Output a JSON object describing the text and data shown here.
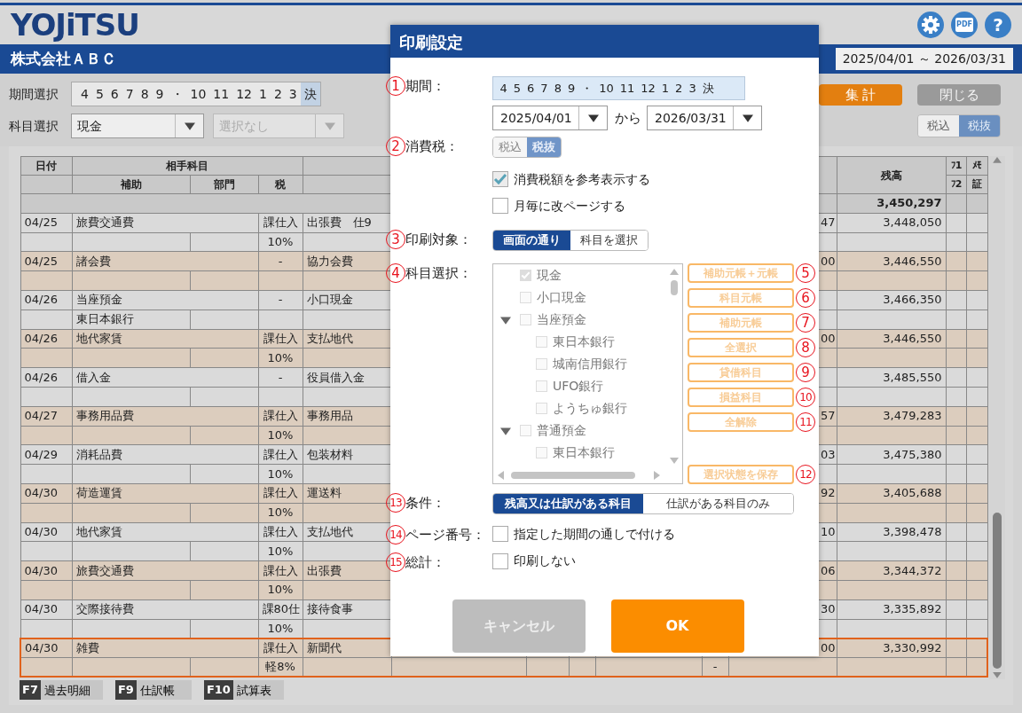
{
  "app": {
    "logo": "YOJiTSU",
    "pdf_label": "PDF",
    "help_glyph": "?",
    "company": "株式会社ＡＢＣ",
    "period_range": "2025/04/01 ～ 2026/03/31"
  },
  "filters": {
    "period_label": "期間選択",
    "months": [
      {
        "label": "4",
        "selected": false
      },
      {
        "label": "5",
        "selected": false
      },
      {
        "label": "6",
        "selected": false
      },
      {
        "label": "7",
        "selected": false
      },
      {
        "label": "8",
        "selected": false
      },
      {
        "label": "9",
        "selected": false
      },
      {
        "label": "・",
        "selected": false
      },
      {
        "label": "10",
        "selected": false
      },
      {
        "label": "11",
        "selected": false
      },
      {
        "label": "12",
        "selected": false
      },
      {
        "label": "1",
        "selected": false
      },
      {
        "label": "2",
        "selected": false
      },
      {
        "label": "3",
        "selected": false
      },
      {
        "label": "決",
        "selected": true
      }
    ],
    "account_label": "科目選択",
    "account": "現金",
    "sub_account_placeholder": "選択なし"
  },
  "actions": [
    {
      "label": "集 計",
      "kind": "primary"
    },
    {
      "label": "閉じる",
      "kind": "disabled"
    }
  ],
  "tax_toggle": [
    {
      "label": "税込",
      "selected": false
    },
    {
      "label": "税抜",
      "selected": true
    }
  ],
  "table": {
    "header": {
      "date": "日付",
      "counterpart": "相手科目",
      "sub": "補助",
      "dept": "部門",
      "tax": "税",
      "balance": "残高",
      "f1": "ﾌ1",
      "f2": "ﾌ2",
      "memo": "ﾒﾓ",
      "voucher": "証"
    },
    "total": "3,450,297",
    "rows": [
      {
        "date": "04/25",
        "account": "旅費交通費",
        "tax": "課仕入",
        "rate": "10%",
        "column_5": "出張費　仕9",
        "column_11": "47",
        "balance": "3,448,050",
        "selected": false
      },
      {
        "date": "04/25",
        "account": "諸会費",
        "tax": "-",
        "column_5": "協力会費",
        "column_11": "00",
        "balance": "3,446,550",
        "selected": false
      },
      {
        "date": "04/26",
        "account": "当座預金",
        "sub": "東日本銀行",
        "tax": "-",
        "column_5": "小口現金",
        "balance": "3,466,350",
        "selected": false
      },
      {
        "date": "04/26",
        "account": "地代家賃",
        "tax": "課仕入",
        "rate": "10%",
        "column_5": "支払地代",
        "column_11": "00",
        "balance": "3,446,550",
        "selected": false
      },
      {
        "date": "04/26",
        "account": "借入金",
        "tax": "-",
        "column_5": "役員借入金",
        "balance": "3,485,550",
        "selected": false
      },
      {
        "date": "04/27",
        "account": "事務用品費",
        "tax": "課仕入",
        "rate": "10%",
        "column_5": "事務用品",
        "column_11": "57",
        "balance": "3,479,283",
        "selected": false
      },
      {
        "date": "04/29",
        "account": "消耗品費",
        "tax": "課仕入",
        "rate": "10%",
        "column_5": "包装材料",
        "column_11": "03",
        "balance": "3,475,380",
        "selected": false
      },
      {
        "date": "04/30",
        "account": "荷造運賃",
        "tax": "課仕入",
        "rate": "10%",
        "column_5": "運送料",
        "column_11": "92",
        "balance": "3,405,688",
        "selected": false
      },
      {
        "date": "04/30",
        "account": "地代家賃",
        "tax": "課仕入",
        "rate": "10%",
        "column_5": "支払地代",
        "column_11": "10",
        "balance": "3,398,478",
        "selected": false
      },
      {
        "date": "04/30",
        "account": "旅費交通費",
        "tax": "課仕入",
        "rate": "10%",
        "column_5": "出張費",
        "column_11": "06",
        "balance": "3,344,372",
        "selected": false
      },
      {
        "date": "04/30",
        "account": "交際接待費",
        "tax": "課80仕",
        "rate": "10%",
        "column_5": "接待食事",
        "column_11": "30",
        "balance": "3,335,892",
        "selected": false
      },
      {
        "date": "04/30",
        "account": "雑費",
        "tax": "課仕入",
        "rate": "軽8%",
        "column_5": "新聞代",
        "column_11": "00",
        "column_10_line2": "-",
        "balance": "3,330,992",
        "selected": true
      }
    ]
  },
  "function_keys": [
    {
      "key": "F7",
      "label": "過去明細"
    },
    {
      "key": "F9",
      "label": "仕訳帳"
    },
    {
      "key": "F10",
      "label": "試算表"
    }
  ],
  "dialog": {
    "title": "印刷設定",
    "period": {
      "marker": "1",
      "label": "期間：",
      "months": [
        {
          "label": "4",
          "selected": true
        },
        {
          "label": "5",
          "selected": true
        },
        {
          "label": "6",
          "selected": true
        },
        {
          "label": "7",
          "selected": true
        },
        {
          "label": "8",
          "selected": true
        },
        {
          "label": "9",
          "selected": true
        },
        {
          "label": "・",
          "selected": true
        },
        {
          "label": "10",
          "selected": true
        },
        {
          "label": "11",
          "selected": true
        },
        {
          "label": "12",
          "selected": true
        },
        {
          "label": "1",
          "selected": true
        },
        {
          "label": "2",
          "selected": true
        },
        {
          "label": "3",
          "selected": true
        },
        {
          "label": "決",
          "selected": true
        }
      ],
      "from": "2025/04/01",
      "connector": "から",
      "to": "2026/03/31"
    },
    "tax": {
      "marker": "2",
      "label": "消費税：",
      "options": [
        {
          "label": "税込",
          "selected": false
        },
        {
          "label": "税抜",
          "selected": true
        }
      ],
      "checkboxes": [
        {
          "label": "消費税額を参考表示する",
          "checked": true
        },
        {
          "label": "月毎に改ページする",
          "checked": false
        }
      ]
    },
    "target": {
      "marker": "3",
      "label": "印刷対象：",
      "options": [
        {
          "label": "画面の通り",
          "selected": true
        },
        {
          "label": "科目を選択",
          "selected": false
        }
      ]
    },
    "accounts": {
      "marker": "4",
      "label": "科目選択：",
      "disabled": true,
      "tree": [
        {
          "label": "現金",
          "checked": true
        },
        {
          "label": "小口現金",
          "checked": false
        },
        {
          "label": "当座預金",
          "checked": false,
          "expanded": true,
          "children": [
            {
              "label": "東日本銀行",
              "checked": false
            },
            {
              "label": "城南信用銀行",
              "checked": false
            },
            {
              "label": "UFO銀行",
              "checked": false
            },
            {
              "label": "ようちゅ銀行",
              "checked": false
            }
          ]
        },
        {
          "label": "普通預金",
          "checked": false,
          "expanded": true,
          "children": [
            {
              "label": "東日本銀行",
              "checked": false
            }
          ]
        }
      ],
      "buttons": [
        {
          "label": "補助元帳＋元帳",
          "marker": "5",
          "disabled": true
        },
        {
          "label": "科目元帳",
          "marker": "6",
          "disabled": true
        },
        {
          "label": "補助元帳",
          "marker": "7",
          "disabled": true
        },
        {
          "label": "全選択",
          "marker": "8",
          "disabled": true
        },
        {
          "label": "貸借科目",
          "marker": "9",
          "disabled": true
        },
        {
          "label": "損益科目",
          "marker": "10",
          "disabled": true
        },
        {
          "label": "全解除",
          "marker": "11",
          "disabled": true
        }
      ],
      "save_button": {
        "label": "選択状態を保存",
        "marker": "12",
        "disabled": true
      }
    },
    "condition": {
      "marker": "13",
      "label": "条件：",
      "options": [
        {
          "label": "残高又は仕訳がある科目",
          "selected": true
        },
        {
          "label": "仕訳がある科目のみ",
          "selected": false
        }
      ]
    },
    "page_number": {
      "marker": "14",
      "label": "ページ番号：",
      "checkbox": {
        "label": "指定した期間の通しで付ける",
        "checked": false
      }
    },
    "grand_total": {
      "marker": "15",
      "label": "総計：",
      "checkbox": {
        "label": "印刷しない",
        "checked": false
      }
    },
    "buttons": [
      {
        "label": "キャンセル",
        "kind": "cancel"
      },
      {
        "label": "OK",
        "kind": "ok"
      }
    ]
  }
}
